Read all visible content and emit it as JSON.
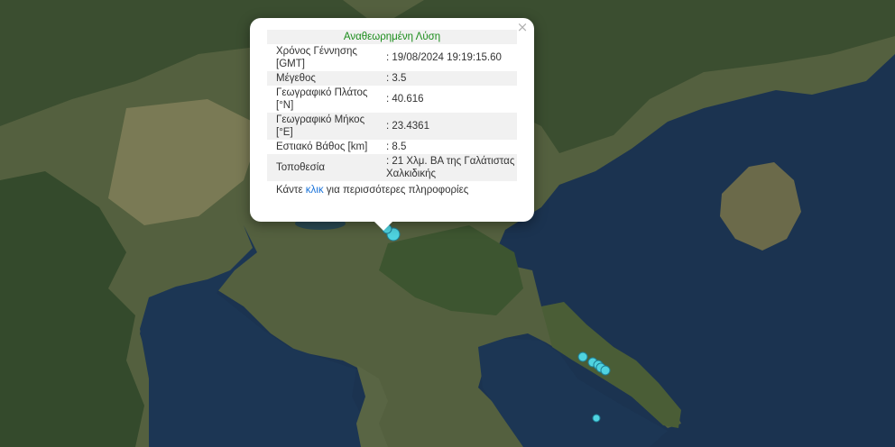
{
  "popup": {
    "close_symbol": "×",
    "title": "Αναθεωρημένη Λύση",
    "rows": [
      {
        "key": "Χρόνος Γέννησης [GMT]",
        "value": ": 19/08/2024 19:19:15.60"
      },
      {
        "key": "Μέγεθος",
        "value": ": 3.5"
      },
      {
        "key": "Γεωγραφικό Πλάτος [°N]",
        "value": ": 40.616"
      },
      {
        "key": "Γεωγραφικό Μήκος [°E]",
        "value": ": 23.4361"
      },
      {
        "key": "Εστιακό Βάθος [km]",
        "value": ": 8.5"
      },
      {
        "key": "Τοποθεσία",
        "value": ": 21 Χλμ. ΒΑ της Γαλάτιστας Χαλκιδικής"
      }
    ],
    "footer": {
      "prefix": "Κάντε ",
      "link": "κλικ",
      "suffix": " για περισσότερες πληροφορίες"
    }
  },
  "map": {
    "colors": {
      "sea": "#1b3350",
      "land": "#4a5a3c",
      "forest": "#2f4a2a",
      "marker": "#4fd3e0",
      "marker_stroke": "#1f7f95"
    },
    "markers": [
      {
        "label": "selected-earthquake",
        "magnitude": 3.5
      },
      {
        "label": "earthquake"
      },
      {
        "label": "earthquake"
      },
      {
        "label": "earthquake"
      },
      {
        "label": "earthquake"
      },
      {
        "label": "earthquake"
      },
      {
        "label": "earthquake"
      },
      {
        "label": "earthquake"
      }
    ]
  }
}
